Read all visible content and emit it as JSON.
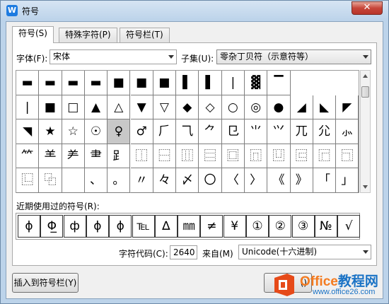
{
  "window": {
    "title": "符号",
    "app_icon": "W",
    "close_label": "✕",
    "accent": "#1d7be0"
  },
  "tabs": [
    {
      "label": "符号(S)",
      "active": true
    },
    {
      "label": "特殊字符(P)",
      "active": false
    },
    {
      "label": "符号栏(T)",
      "active": false
    }
  ],
  "font": {
    "label": "字体(F):",
    "value": "宋体"
  },
  "subset": {
    "label": "子集(U):",
    "value": "零杂丁贝符（示意符等）"
  },
  "symbols": [
    [
      "▬",
      "▬",
      "▬",
      "▬",
      "■",
      "■",
      "■",
      "▌",
      "▌",
      "|",
      "▓",
      "▔"
    ],
    [
      "|",
      "■",
      "□",
      "▲",
      "△",
      "▼",
      "▽",
      "◆",
      "◇",
      "○",
      "◎",
      "●",
      "◢",
      "◣",
      "◤"
    ],
    [
      "◥",
      "★",
      "☆",
      "☉",
      "♀",
      "♂",
      "⺁",
      "⺄",
      "⺈",
      "⺋",
      "⺌",
      "⺍",
      "⺎",
      "⺏",
      "⺗"
    ],
    [
      "⺮",
      "⺷",
      "⺶",
      "⺻",
      "⻊",
      "⿰",
      "⿱",
      "⿲",
      "⿳",
      "⿴",
      "⿵",
      "⿶",
      "⿷",
      "⿸",
      "⿹"
    ],
    [
      "⿺",
      "⿻",
      "",
      "、",
      "。",
      "〃",
      "々",
      "〆",
      "〇",
      "〈",
      "〉",
      "《",
      "》",
      "「",
      "」"
    ]
  ],
  "selected_symbol": "♀",
  "recent": {
    "label": "近期使用过的符号(R):",
    "items": [
      "ɸ",
      "Φ̲",
      "ф",
      "ϕ",
      "ɸ",
      "℡",
      "∆",
      "㎜",
      "≠",
      "¥",
      "①",
      "②",
      "③",
      "№",
      "√"
    ]
  },
  "char_code": {
    "label": "字符代码(C):",
    "value": "2640"
  },
  "from": {
    "label": "来自(M)",
    "value": "Unicode(十六进制)"
  },
  "buttons": {
    "insert_to_bar": "插入到符号栏(Y)",
    "partial": "()"
  },
  "watermark": {
    "brand_a": "Office",
    "brand_b": "教程网",
    "url": "www.office26.com"
  }
}
